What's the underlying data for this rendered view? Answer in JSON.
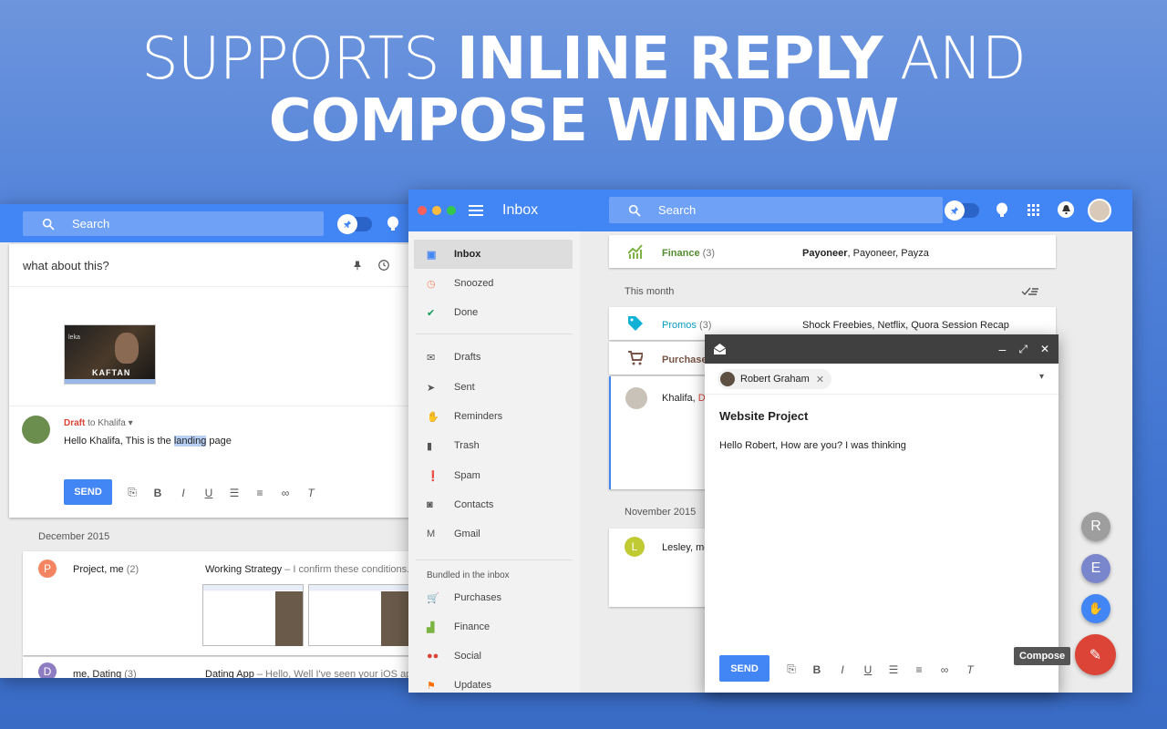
{
  "headline": {
    "line1_light": "SUPPORTS ",
    "line1_bold": "INLINE REPLY",
    "line1_end": " AND",
    "line2": "COMPOSE WINDOW"
  },
  "back_window": {
    "search_placeholder": "Search",
    "thread_subject": "what about this?",
    "attachment_title": "KAFTAN",
    "attachment_brand": "leka",
    "draft_label": "Draft",
    "draft_to": "to Khalifa",
    "draft_text_before": "Hello Khalifa, This is the ",
    "draft_highlight": "landing",
    "draft_text_after": " page",
    "send_label": "SEND",
    "section_label": "December 2015",
    "rows": [
      {
        "avatar": "P",
        "sender": "Project, me",
        "count": "(2)",
        "subject": "Working Strategy",
        "snippet": " – I confirm these conditions. Bes",
        "avatar_color": "#f4845f"
      },
      {
        "avatar": "D",
        "sender": "me, Dating",
        "count": "(3)",
        "subject": "Dating App",
        "snippet": " – Hello, Well I've seen your iOS app. I",
        "avatar_color": "#8e7cc3"
      }
    ]
  },
  "main_window": {
    "title": "Inbox",
    "search_placeholder": "Search",
    "nav": [
      {
        "label": "Inbox",
        "icon": "inbox-icon",
        "active": true
      },
      {
        "label": "Snoozed",
        "icon": "clock-icon"
      },
      {
        "label": "Done",
        "icon": "check-icon"
      },
      {
        "label": "Drafts",
        "icon": "drafts-icon"
      },
      {
        "label": "Sent",
        "icon": "send-icon"
      },
      {
        "label": "Reminders",
        "icon": "reminder-hand-icon"
      },
      {
        "label": "Trash",
        "icon": "trash-icon"
      },
      {
        "label": "Spam",
        "icon": "spam-icon"
      },
      {
        "label": "Contacts",
        "icon": "contacts-icon"
      },
      {
        "label": "Gmail",
        "icon": "gmail-icon"
      }
    ],
    "bundled_label": "Bundled in the inbox",
    "bundles": [
      {
        "label": "Purchases",
        "icon": "cart-icon"
      },
      {
        "label": "Finance",
        "icon": "finance-chart-icon"
      },
      {
        "label": "Social",
        "icon": "people-icon"
      },
      {
        "label": "Updates",
        "icon": "flag-icon"
      }
    ],
    "finance_row": {
      "label": "Finance",
      "count": "(3)",
      "senders_bold": "Payoneer",
      "senders_rest": ", Payoneer, Payza"
    },
    "this_month_label": "This month",
    "promos_row": {
      "label": "Promos",
      "count": "(3)",
      "senders": "Shock Freebies, Netflix, Quora Session Recap"
    },
    "purchases_row": {
      "label": "Purchase"
    },
    "khalifa_row": {
      "sender": "Khalifa, ",
      "draft": "Dr"
    },
    "november_label": "November 2015",
    "lesley_row": {
      "avatar": "L",
      "sender": "Lesley, me"
    }
  },
  "compose": {
    "recipient": "Robert Graham",
    "subject": "Website Project",
    "body": "Hello Robert, How are you? I was thinking",
    "send_label": "SEND"
  },
  "fabs": {
    "r": "R",
    "e": "E",
    "tooltip": "Compose"
  }
}
